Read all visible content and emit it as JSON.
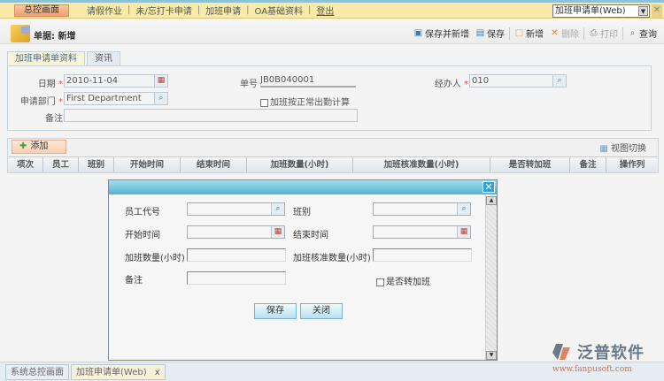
{
  "nav": {
    "home": "总控画面",
    "items": [
      "请假作业",
      "未/忘打卡申请",
      "加班申请",
      "OA基础资料"
    ],
    "logout": "登出",
    "doc_select": "加班申请单(Web)"
  },
  "header": {
    "title": "单据: 新增"
  },
  "toolbar": {
    "save_new": "保存并新增",
    "save": "保存",
    "new": "新增",
    "delete": "删除",
    "print": "打印",
    "query": "查询"
  },
  "tabs": [
    "加班申请单资料",
    "资讯"
  ],
  "form": {
    "date_label": "日期",
    "date_value": "2010-11-04",
    "doc_no_label": "单号",
    "doc_no_value": "JB0B040001",
    "handler_label": "经办人",
    "handler_value": "010",
    "dept_label": "申请部门",
    "dept_value": "First Department",
    "calc_label": "加班按正常出勤计算",
    "remark_label": "备注",
    "remark_value": ""
  },
  "grid": {
    "add": "添加",
    "view_switch": "视图切换",
    "columns": [
      "项次",
      "员工",
      "班别",
      "开始时间",
      "结束时间",
      "加班数量(小时)",
      "加班核准数量(小时)",
      "是否转加班",
      "备注",
      "操作列"
    ]
  },
  "modal": {
    "emp_label": "员工代号",
    "shift_label": "班别",
    "start_label": "开始时间",
    "end_label": "结束时间",
    "qty_label": "加班数量(小时)",
    "approved_label": "加班核准数量(小时)",
    "remark_label": "备注",
    "convert_label": "是否转加班",
    "save": "保存",
    "close": "关闭"
  },
  "bottom_tabs": [
    "系统总控画面",
    "加班申请单(Web)"
  ],
  "logo": {
    "name": "泛普软件",
    "url": "www.fanpusoft.com"
  }
}
